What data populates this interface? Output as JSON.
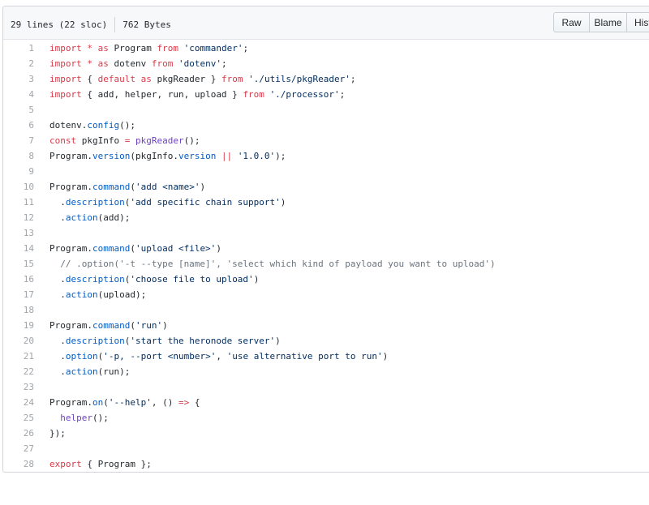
{
  "header": {
    "lines_info": "29 lines (22 sloc)",
    "size_info": "762 Bytes",
    "raw_label": "Raw",
    "blame_label": "Blame",
    "history_label": "History"
  },
  "code_lines": [
    {
      "n": "1",
      "text": "import * as Program from 'commander';"
    },
    {
      "n": "2",
      "text": "import * as dotenv from 'dotenv';"
    },
    {
      "n": "3",
      "text": "import { default as pkgReader } from './utils/pkgReader';"
    },
    {
      "n": "4",
      "text": "import { add, helper, run, upload } from './processor';"
    },
    {
      "n": "5",
      "text": ""
    },
    {
      "n": "6",
      "text": "dotenv.config();"
    },
    {
      "n": "7",
      "text": "const pkgInfo = pkgReader();"
    },
    {
      "n": "8",
      "text": "Program.version(pkgInfo.version || '1.0.0');"
    },
    {
      "n": "9",
      "text": ""
    },
    {
      "n": "10",
      "text": "Program.command('add <name>')"
    },
    {
      "n": "11",
      "text": "  .description('add specific chain support')"
    },
    {
      "n": "12",
      "text": "  .action(add);"
    },
    {
      "n": "13",
      "text": ""
    },
    {
      "n": "14",
      "text": "Program.command('upload <file>')"
    },
    {
      "n": "15",
      "text": "  // .option('-t --type [name]', 'select which kind of payload you want to upload')"
    },
    {
      "n": "16",
      "text": "  .description('choose file to upload')"
    },
    {
      "n": "17",
      "text": "  .action(upload);"
    },
    {
      "n": "18",
      "text": ""
    },
    {
      "n": "19",
      "text": "Program.command('run')"
    },
    {
      "n": "20",
      "text": "  .description('start the heronode server')"
    },
    {
      "n": "21",
      "text": "  .option('-p, --port <number>', 'use alternative port to run')"
    },
    {
      "n": "22",
      "text": "  .action(run);"
    },
    {
      "n": "23",
      "text": ""
    },
    {
      "n": "24",
      "text": "Program.on('--help', () => {"
    },
    {
      "n": "25",
      "text": "  helper();"
    },
    {
      "n": "26",
      "text": "});"
    },
    {
      "n": "27",
      "text": ""
    },
    {
      "n": "28",
      "text": "export { Program };"
    }
  ]
}
